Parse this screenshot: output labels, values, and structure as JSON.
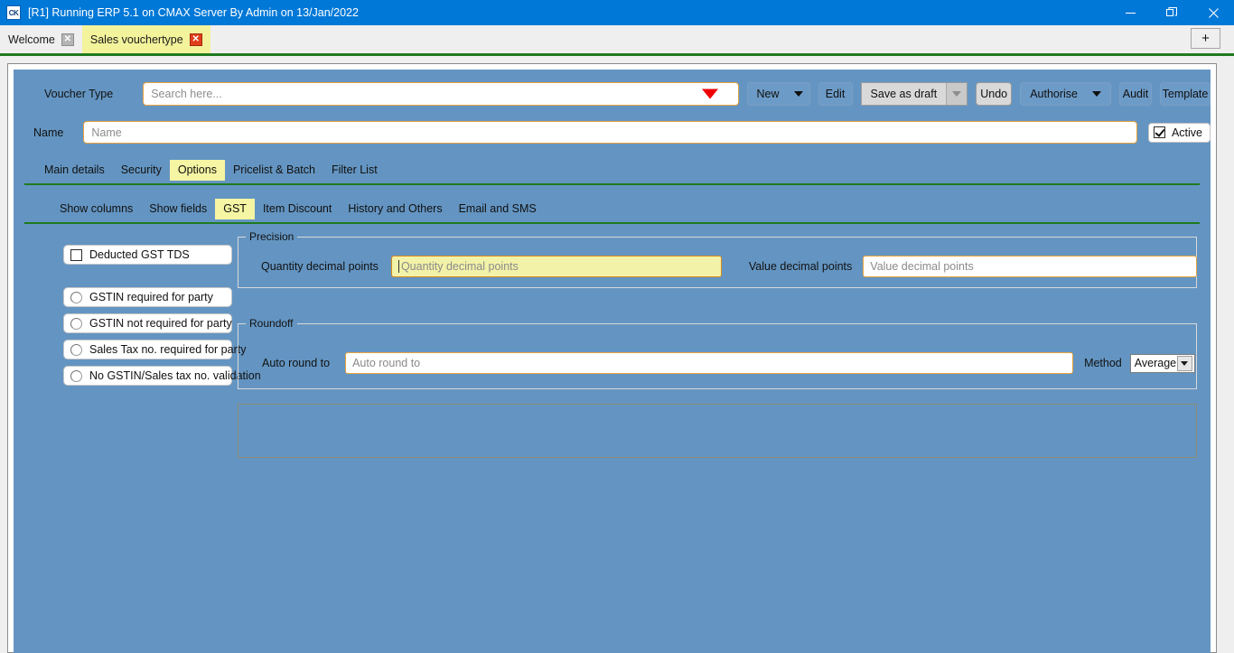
{
  "window": {
    "title": "[R1] Running ERP 5.1 on CMAX Server By Admin on 13/Jan/2022",
    "logo_text": "CK",
    "minimize_icon": "minimize-icon",
    "restore_icon": "restore-icon",
    "close_icon": "close-icon"
  },
  "doc_tabs": {
    "items": [
      {
        "label": "Welcome",
        "close": "✕",
        "active": false
      },
      {
        "label": "Sales vouchertype",
        "close": "✕",
        "active": true
      }
    ],
    "new_tab_label": "+"
  },
  "form": {
    "voucher_type_label": "Voucher Type",
    "voucher_search_placeholder": "Search here...",
    "name_label": "Name",
    "name_placeholder": "Name",
    "active_label": "Active",
    "active_checked": true
  },
  "toolbar": {
    "new_label": "New",
    "edit_label": "Edit",
    "save_as_draft_label": "Save as draft",
    "undo_label": "Undo",
    "authorise_label": "Authorise",
    "audit_label": "Audit",
    "template_label": "Template"
  },
  "primary_tabs": {
    "items": [
      "Main details",
      "Security",
      "Options",
      "Pricelist & Batch",
      "Filter List"
    ],
    "selected": "Options"
  },
  "secondary_tabs": {
    "items": [
      "Show columns",
      "Show fields",
      "GST",
      "Item Discount",
      "History and Others",
      "Email and SMS"
    ],
    "selected": "GST"
  },
  "gst_options": {
    "deducted_gst_tds": "Deducted GST TDS",
    "deducted_gst_tds_checked": false,
    "radios": [
      "GSTIN required for party",
      "GSTIN not required for party",
      "Sales Tax no. required for party",
      "No GSTIN/Sales tax no. validation"
    ],
    "radio_selected": ""
  },
  "precision": {
    "group_title": "Precision",
    "quantity_label": "Quantity decimal points",
    "quantity_placeholder": "Quantity decimal points",
    "quantity_value": "",
    "value_label": "Value decimal points",
    "value_placeholder": "Value decimal points",
    "value_value": ""
  },
  "roundoff": {
    "group_title": "Roundoff",
    "auto_round_label": "Auto round to",
    "auto_round_placeholder": "Auto round to",
    "auto_round_value": "",
    "method_label": "Method",
    "method_value": "Average"
  },
  "colors": {
    "titlebar": "#0078d7",
    "form_background": "#6495c2",
    "tab_highlight": "#f5f5a3",
    "field_border": "#e8a33d",
    "focus_field_background": "#f2f2a8",
    "rule_green": "#1f7a1f",
    "dropdown_arrow_red": "#ee0000",
    "close_tab_red": "#e03e1a"
  }
}
